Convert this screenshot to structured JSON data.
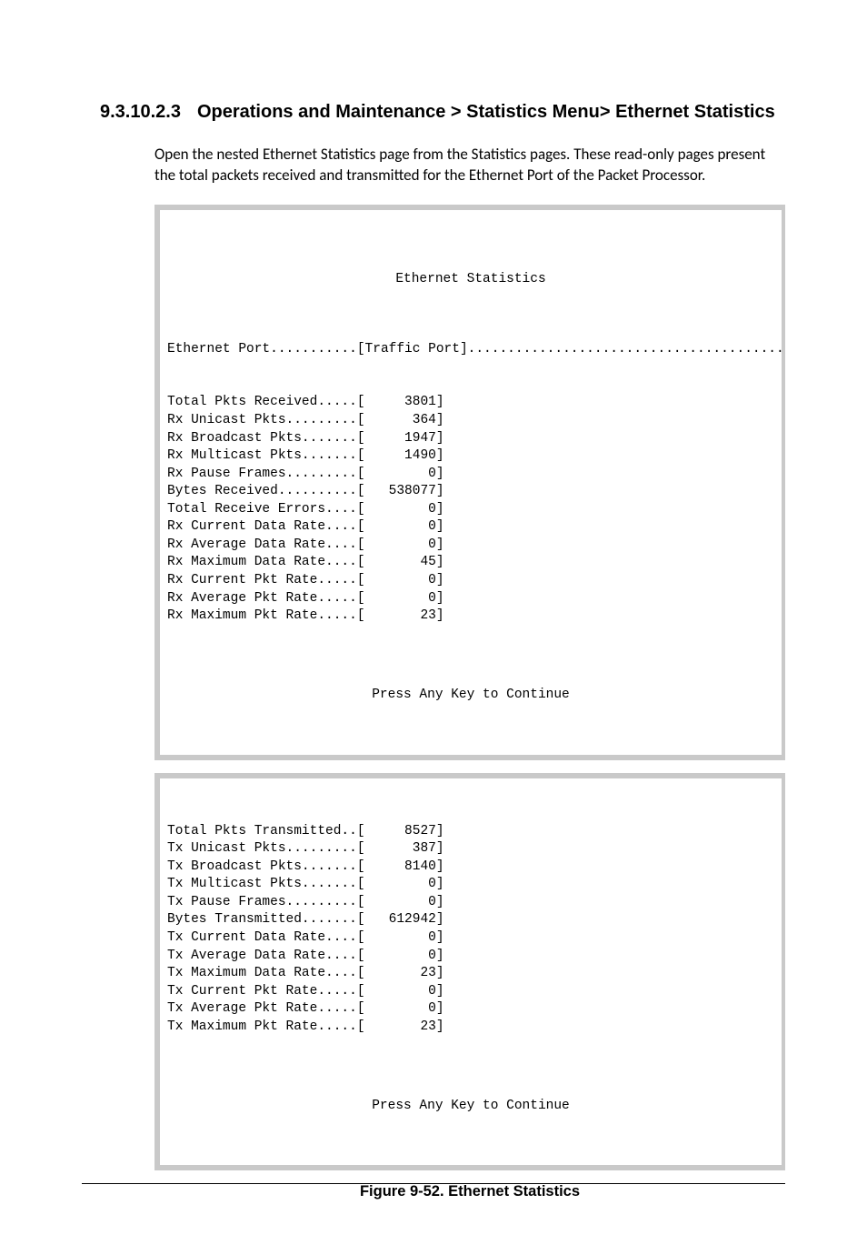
{
  "heading": {
    "number": "9.3.10.2.3",
    "title": "Operations and Maintenance > Statistics Menu> Ethernet Statistics"
  },
  "intro": "Open the nested Ethernet Statistics page from the Statistics pages. These read-only pages present the total packets received and transmitted for the Ethernet Port of the Packet Processor.",
  "terminal1": {
    "title": "Ethernet Statistics",
    "port_line": "Ethernet Port...........[Traffic Port].........................................P",
    "rows": [
      {
        "label": "Total Pkts Received.....",
        "value": "3801"
      },
      {
        "label": "Rx Unicast Pkts.........",
        "value": "364"
      },
      {
        "label": "Rx Broadcast Pkts.......",
        "value": "1947"
      },
      {
        "label": "Rx Multicast Pkts.......",
        "value": "1490"
      },
      {
        "label": "Rx Pause Frames.........",
        "value": "0"
      },
      {
        "label": "Bytes Received..........",
        "value": "538077"
      },
      {
        "label": "Total Receive Errors....",
        "value": "0"
      },
      {
        "label": "Rx Current Data Rate....",
        "value": "0"
      },
      {
        "label": "Rx Average Data Rate....",
        "value": "0"
      },
      {
        "label": "Rx Maximum Data Rate....",
        "value": "45"
      },
      {
        "label": "Rx Current Pkt Rate.....",
        "value": "0"
      },
      {
        "label": "Rx Average Pkt Rate.....",
        "value": "0"
      },
      {
        "label": "Rx Maximum Pkt Rate.....",
        "value": "23"
      }
    ],
    "footer": "Press Any Key to Continue"
  },
  "terminal2": {
    "rows": [
      {
        "label": "Total Pkts Transmitted..",
        "value": "8527"
      },
      {
        "label": "Tx Unicast Pkts.........",
        "value": "387"
      },
      {
        "label": "Tx Broadcast Pkts.......",
        "value": "8140"
      },
      {
        "label": "Tx Multicast Pkts.......",
        "value": "0"
      },
      {
        "label": "Tx Pause Frames.........",
        "value": "0"
      },
      {
        "label": "Bytes Transmitted.......",
        "value": "612942"
      },
      {
        "label": "Tx Current Data Rate....",
        "value": "0"
      },
      {
        "label": "Tx Average Data Rate....",
        "value": "0"
      },
      {
        "label": "Tx Maximum Data Rate....",
        "value": "23"
      },
      {
        "label": "Tx Current Pkt Rate.....",
        "value": "0"
      },
      {
        "label": "Tx Average Pkt Rate.....",
        "value": "0"
      },
      {
        "label": "Tx Maximum Pkt Rate.....",
        "value": "23"
      }
    ],
    "footer": "Press Any Key to Continue"
  },
  "figure_caption": "Figure 9-52. Ethernet Statistics"
}
